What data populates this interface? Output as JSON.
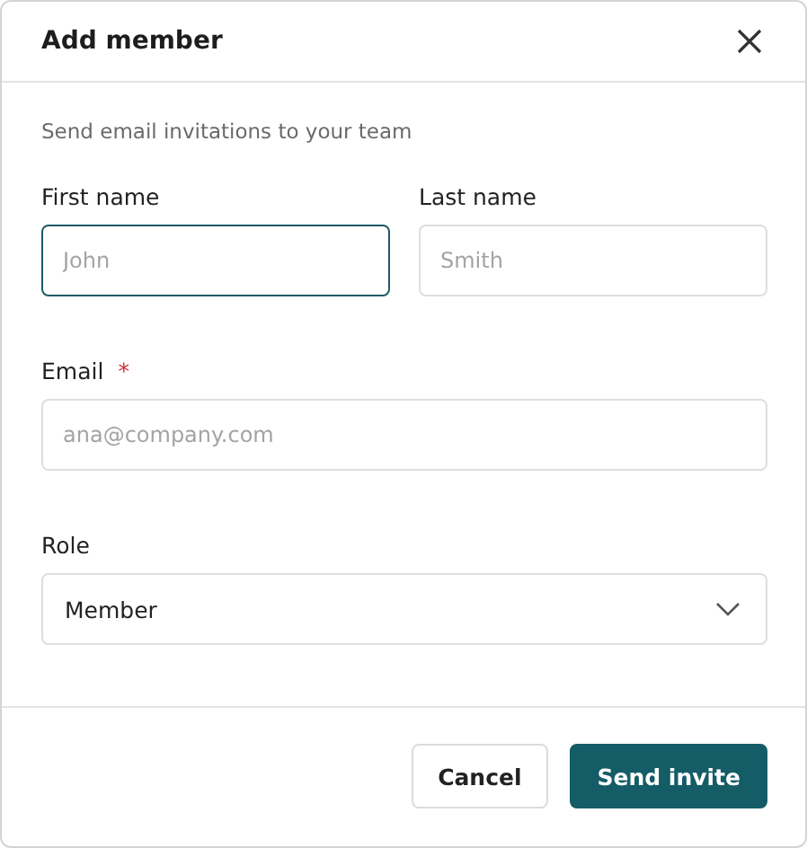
{
  "dialog": {
    "title": "Add member",
    "subtitle": "Send email invitations to your team"
  },
  "name_fields": [
    {
      "label": "First name",
      "placeholder": "John",
      "focused": true
    },
    {
      "label": "Last name",
      "placeholder": "Smith",
      "focused": false
    }
  ],
  "email_field": {
    "label": "Email",
    "required_mark": "*",
    "required": true,
    "placeholder": "ana@company.com",
    "focused": false
  },
  "role_select": {
    "label": "Role",
    "value": "Member"
  },
  "buttons": [
    {
      "label": "Cancel",
      "kind": "secondary"
    },
    {
      "label": "Send invite",
      "kind": "primary"
    }
  ]
}
